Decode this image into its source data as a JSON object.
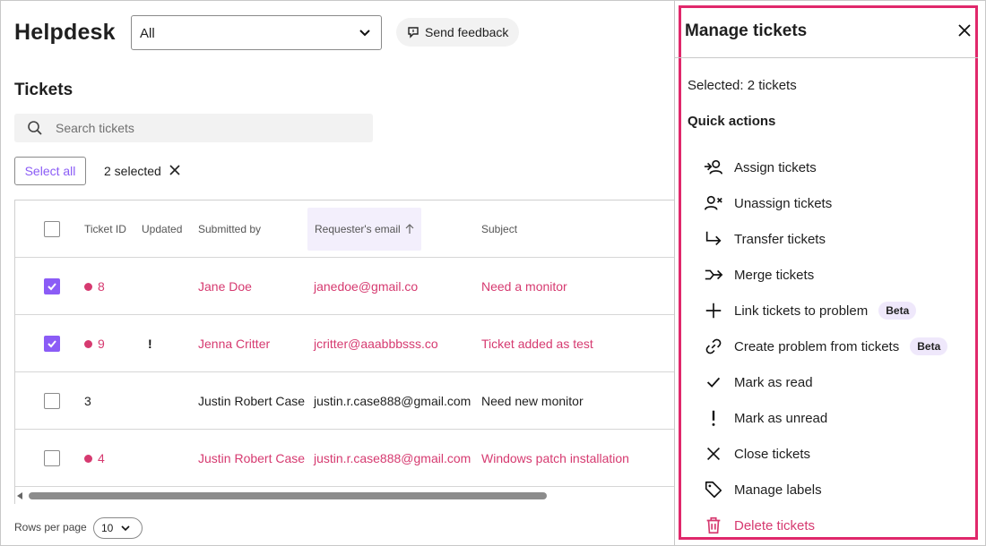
{
  "app": {
    "title": "Helpdesk",
    "filter_value": "All",
    "feedback_label": "Send feedback"
  },
  "tickets": {
    "title": "Tickets",
    "search_placeholder": "Search tickets",
    "select_all_label": "Select all",
    "selected_label": "2 selected",
    "columns": {
      "ticket_id": "Ticket ID",
      "updated": "Updated",
      "submitted_by": "Submitted by",
      "email": "Requester's email",
      "subject": "Subject"
    },
    "sort_icon": "arrow-up-icon",
    "rows": [
      {
        "checked": true,
        "unread": true,
        "id": "8",
        "updated": "",
        "submitted_by": "Jane Doe",
        "email": "janedoe@gmail.co",
        "subject": "Need a monitor"
      },
      {
        "checked": true,
        "unread": true,
        "id": "9",
        "updated": "!",
        "submitted_by": "Jenna Critter",
        "email": "jcritter@aaabbbsss.co",
        "subject": "Ticket added as test"
      },
      {
        "checked": false,
        "unread": false,
        "id": "3",
        "updated": "",
        "submitted_by": "Justin Robert Case",
        "email": "justin.r.case888@gmail.com",
        "subject": "Need new monitor"
      },
      {
        "checked": false,
        "unread": true,
        "id": "4",
        "updated": "",
        "submitted_by": "Justin Robert Case",
        "email": "justin.r.case888@gmail.com",
        "subject": "Windows patch installation"
      }
    ],
    "rows_per_page_label": "Rows per page",
    "rows_per_page_value": "10"
  },
  "panel": {
    "title": "Manage tickets",
    "selected_text": "Selected: 2 tickets",
    "quick_actions_label": "Quick actions",
    "actions": [
      {
        "label": "Assign tickets",
        "icon": "assign-icon",
        "beta": ""
      },
      {
        "label": "Unassign tickets",
        "icon": "unassign-icon",
        "beta": ""
      },
      {
        "label": "Transfer tickets",
        "icon": "transfer-icon",
        "beta": ""
      },
      {
        "label": "Merge tickets",
        "icon": "merge-icon",
        "beta": ""
      },
      {
        "label": "Link tickets to problem",
        "icon": "plus-icon",
        "beta": "Beta"
      },
      {
        "label": "Create problem from tickets",
        "icon": "link-icon",
        "beta": "Beta"
      },
      {
        "label": "Mark as read",
        "icon": "check-icon",
        "beta": ""
      },
      {
        "label": "Mark as unread",
        "icon": "exclamation-icon",
        "beta": ""
      },
      {
        "label": "Close tickets",
        "icon": "close-icon",
        "beta": ""
      },
      {
        "label": "Manage labels",
        "icon": "tag-icon",
        "beta": ""
      },
      {
        "label": "Delete tickets",
        "icon": "trash-icon",
        "beta": ""
      }
    ]
  },
  "colors": {
    "accent_purple": "#8b5cf6",
    "accent_pink": "#d63a70",
    "panel_border": "#e0286b"
  }
}
